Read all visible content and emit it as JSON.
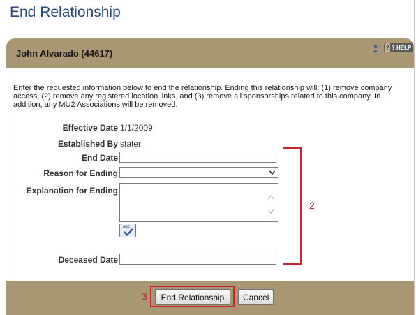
{
  "page_title": "End Relationship",
  "header": {
    "name": "John Alvarado (44617)",
    "help_prefix": "?",
    "help_suffix": "?",
    "help_label": "HELP"
  },
  "instructions": "Enter the requested information below to end the relationship. Ending this relationship will: (1) remove company access, (2) remove any registered location links, and (3) remove all sponsorships related to this company. In addition, any MU2 Associations will be removed.",
  "form": {
    "effective_date_label": "Effective Date",
    "effective_date_value": "1/1/2009",
    "established_by_label": "Established By",
    "established_by_value": "stater",
    "end_date_label": "End Date",
    "end_date_value": "",
    "reason_label": "Reason for Ending",
    "reason_value": "",
    "explanation_label": "Explanation for Ending",
    "explanation_value": "",
    "spellcheck_label": "ABC",
    "deceased_date_label": "Deceased Date",
    "deceased_date_value": ""
  },
  "annotations": {
    "callout_2": "2",
    "callout_3": "3",
    "color": "#c0282e"
  },
  "buttons": {
    "end_relationship": "End Relationship",
    "cancel": "Cancel"
  },
  "colors": {
    "header_bar": "#a99672",
    "title": "#2a4a7a"
  }
}
